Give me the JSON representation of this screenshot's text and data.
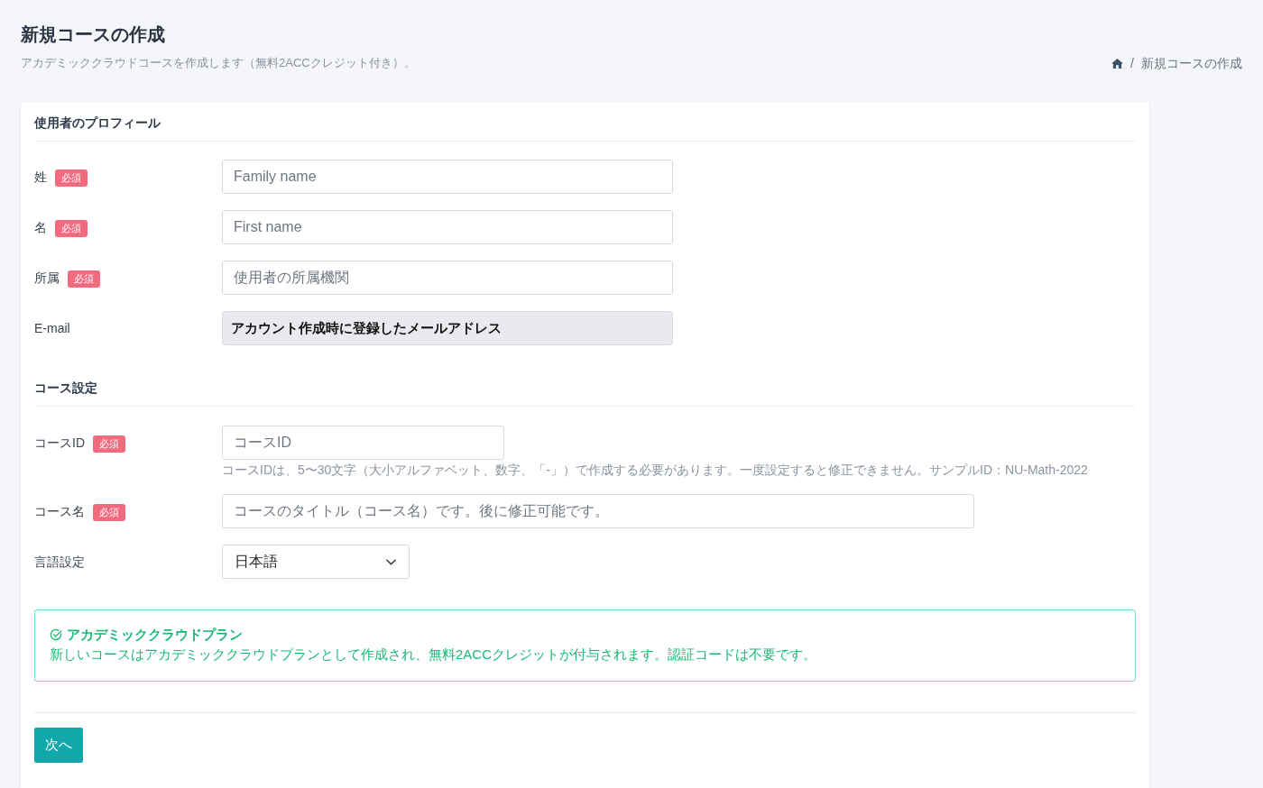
{
  "header": {
    "title": "新規コースの作成",
    "subtitle": "アカデミッククラウドコースを作成します（無料2ACCクレジット付き）。"
  },
  "breadcrumb": {
    "items": [
      {
        "kind": "home"
      },
      {
        "kind": "page",
        "label": "新規コースの作成"
      }
    ],
    "separator": "/"
  },
  "sections": [
    {
      "title": "使用者のプロフィール",
      "fields": [
        {
          "kind": "text",
          "label": "姓",
          "badge": "必須",
          "placeholder": "Family name"
        },
        {
          "kind": "text",
          "label": "名",
          "badge": "必須",
          "placeholder": "First name"
        },
        {
          "kind": "text",
          "label": "所属",
          "badge": "必須",
          "placeholder": "使用者の所属機関"
        },
        {
          "kind": "readonly",
          "label": "E-mail",
          "value": "アカウント作成時に登録したメールアドレス"
        }
      ]
    },
    {
      "title": "コース設定",
      "fields": [
        {
          "kind": "text",
          "label": "コースID",
          "badge": "必須",
          "placeholder": "コースID",
          "help": "コースIDは、5〜30文字（大小アルファベット、数字、「-」）で作成する必要があります。一度設定すると修正できません。サンプルID：NU-Math-2022"
        },
        {
          "kind": "text",
          "label": "コース名",
          "badge": "必須",
          "placeholder": "コースのタイトル（コース名）です。後に修正可能です。"
        },
        {
          "kind": "select",
          "label": "言語設定",
          "value": "日本語"
        }
      ]
    }
  ],
  "notice": {
    "kind": "success",
    "title": "アカデミッククラウドプラン",
    "text": "新しいコースはアカデミッククラウドプランとして作成され、無料2ACCクレジットが付与されます。認証コードは不要です。"
  },
  "submit": {
    "label": "次へ"
  }
}
